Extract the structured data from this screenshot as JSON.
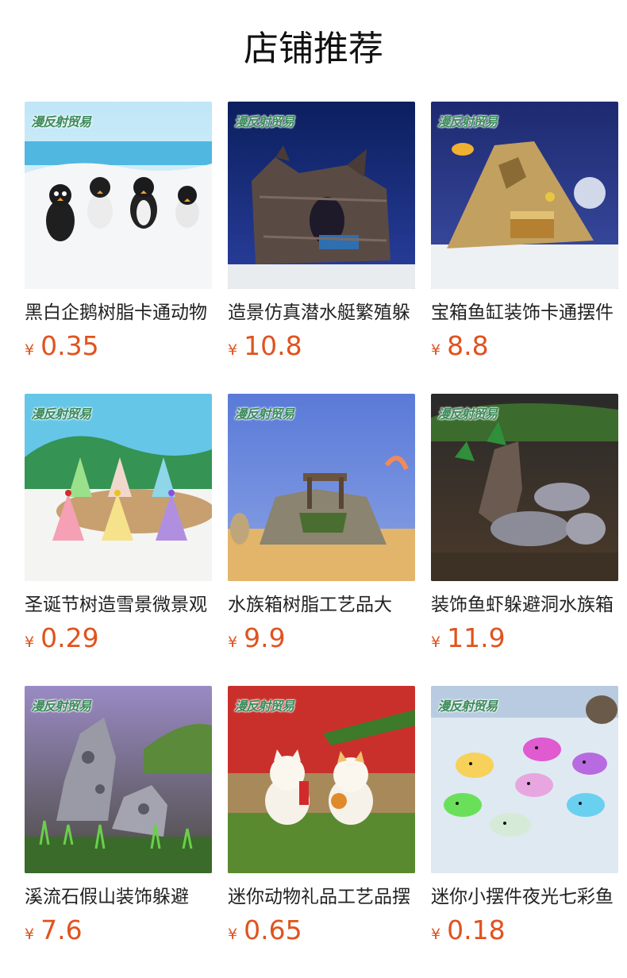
{
  "section_title": "店铺推荐",
  "brand_watermark": "漫反射贸易",
  "currency_symbol": "¥",
  "products": [
    {
      "name": "黑白企鹅树脂卡通动物",
      "price": "0.35",
      "scene": "penguins"
    },
    {
      "name": "造景仿真潜水艇繁殖躲",
      "price": "10.8",
      "scene": "log-cave"
    },
    {
      "name": "宝箱鱼缸装饰卡通摆件",
      "price": "8.8",
      "scene": "treasure"
    },
    {
      "name": "圣诞节树造雪景微景观",
      "price": "0.29",
      "scene": "trees"
    },
    {
      "name": "水族箱树脂工艺品大",
      "price": "9.9",
      "scene": "bridge"
    },
    {
      "name": "装饰鱼虾躲避洞水族箱",
      "price": "11.9",
      "scene": "driftwood"
    },
    {
      "name": "溪流石假山装饰躲避",
      "price": "7.6",
      "scene": "rockery"
    },
    {
      "name": "迷你动物礼品工艺品摆",
      "price": "0.65",
      "scene": "cats"
    },
    {
      "name": "迷你小摆件夜光七彩鱼",
      "price": "0.18",
      "scene": "fish"
    }
  ]
}
